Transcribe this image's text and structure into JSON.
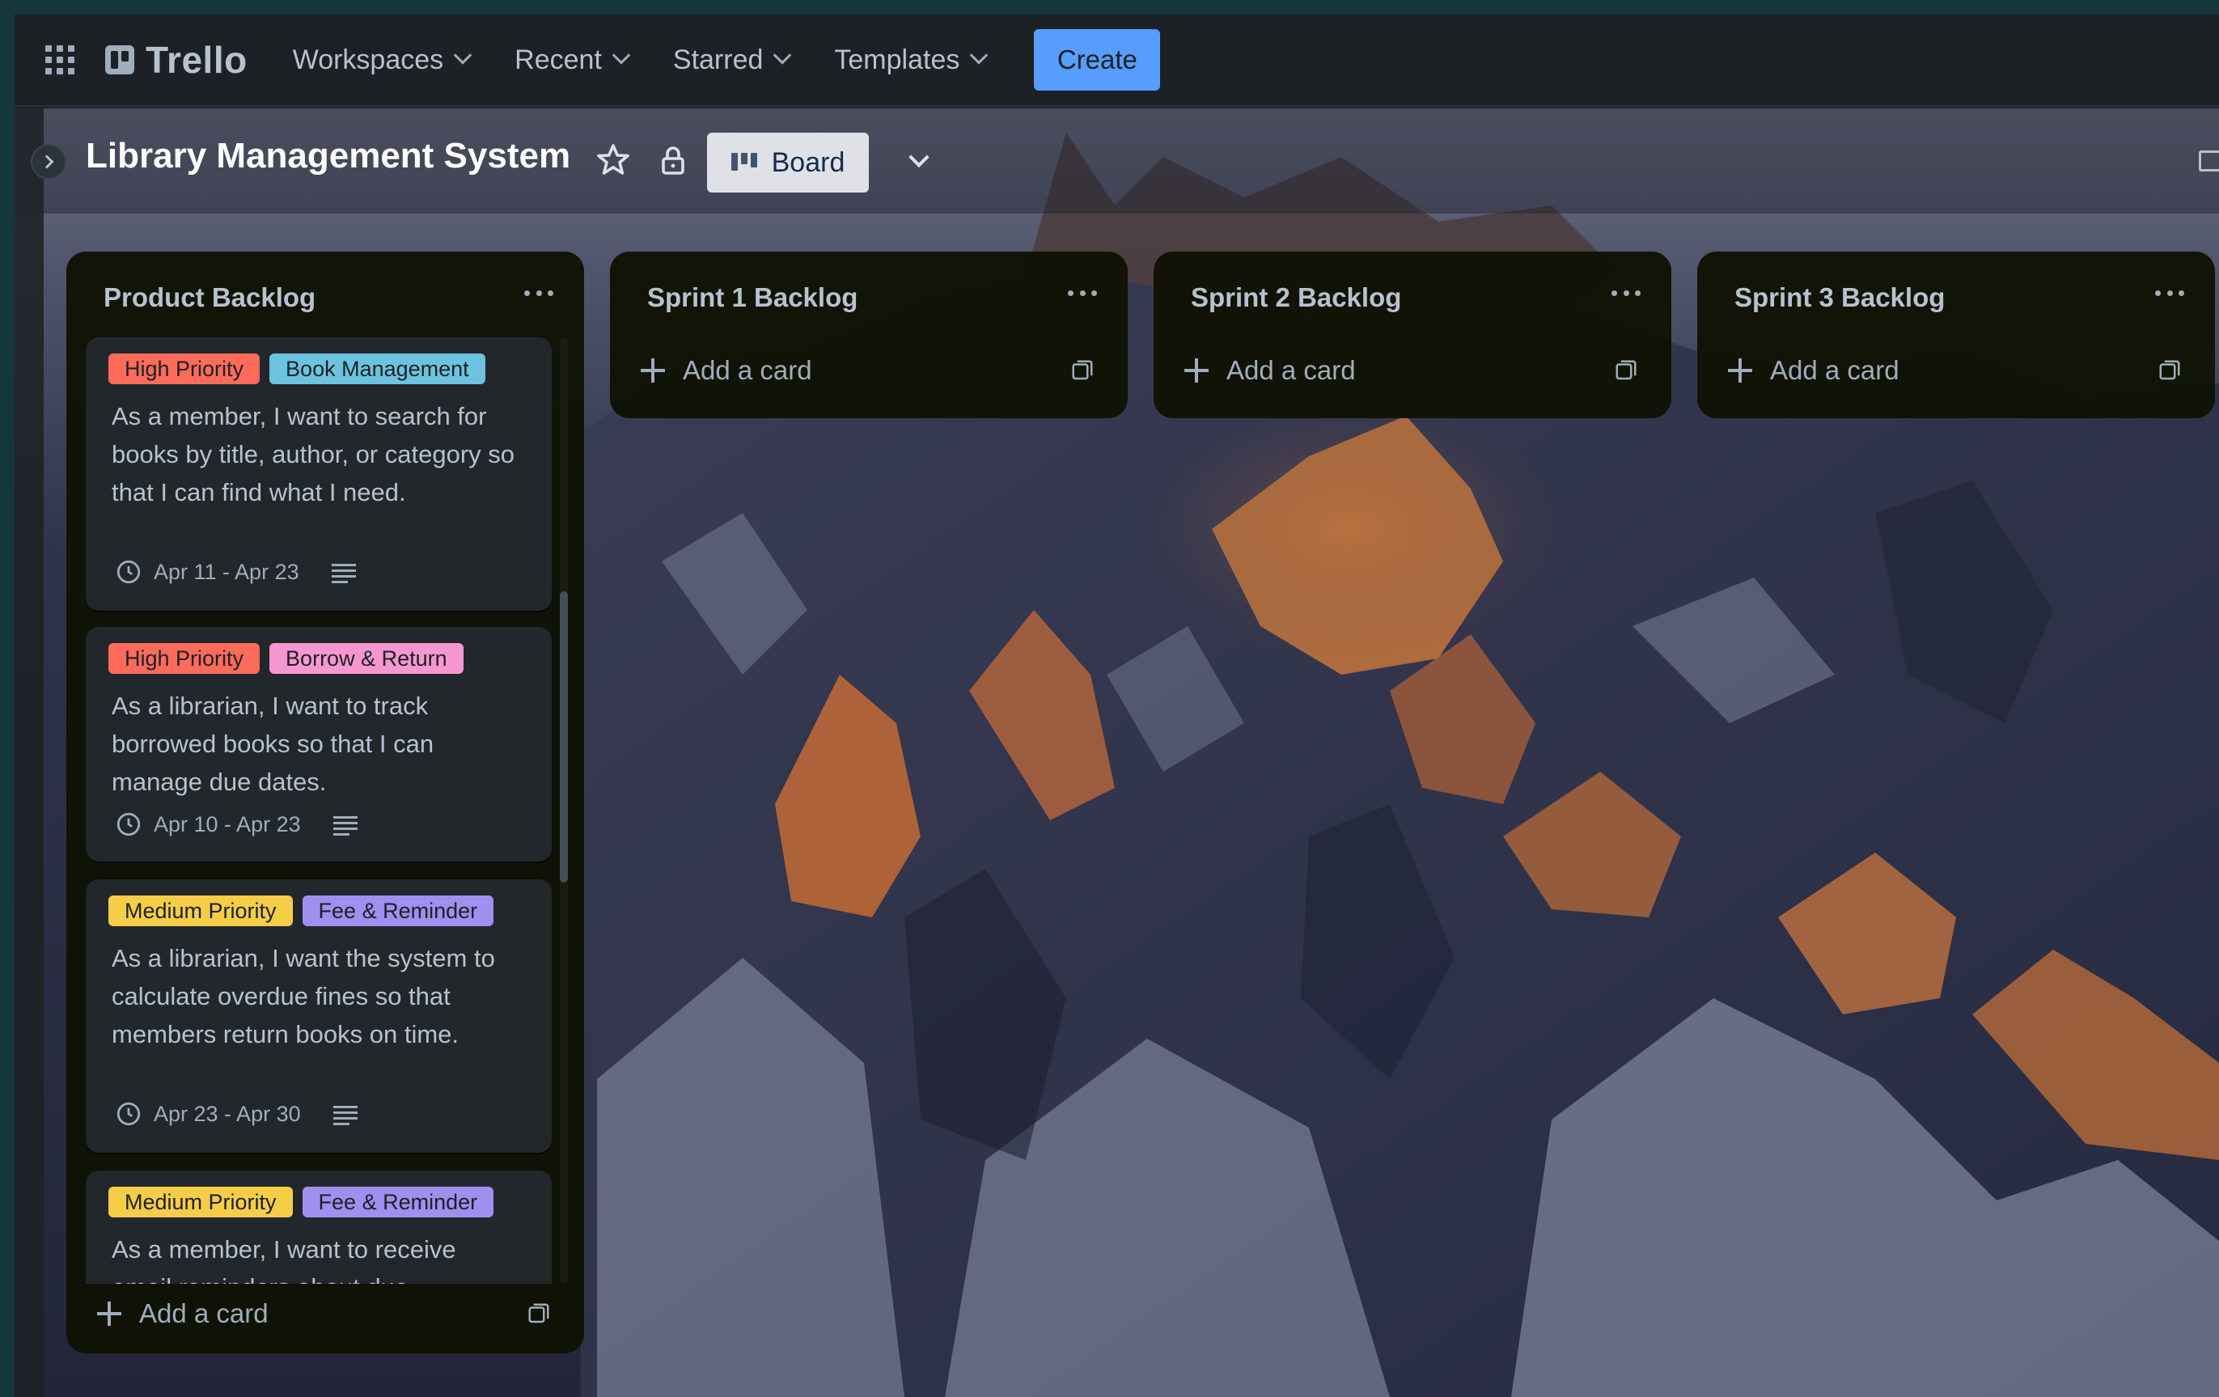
{
  "nav": {
    "logo_text": "Trello",
    "items": [
      {
        "label": "Workspaces"
      },
      {
        "label": "Recent"
      },
      {
        "label": "Starred"
      },
      {
        "label": "Templates"
      }
    ],
    "create_label": "Create"
  },
  "board": {
    "title": "Library Management System",
    "view_label": "Board"
  },
  "lists": [
    {
      "title": "Product Backlog",
      "add_card_label": "Add a card",
      "cards": [
        {
          "labels": [
            {
              "text": "High Priority",
              "bg": "#ff6b5b",
              "fg": "#1d2125"
            },
            {
              "text": "Book Management",
              "bg": "#6cc3e0",
              "fg": "#1d2125"
            }
          ],
          "text": "As a member, I want to search for books by title, author, or category so that I can find what I need.",
          "dates": "Apr 11 - Apr 23"
        },
        {
          "labels": [
            {
              "text": "High Priority",
              "bg": "#ff6b5b",
              "fg": "#1d2125"
            },
            {
              "text": "Borrow & Return",
              "bg": "#f797d2",
              "fg": "#1d2125"
            }
          ],
          "text": "As a librarian, I want to track borrowed books so that I can manage due dates.",
          "dates": "Apr 10 - Apr 23"
        },
        {
          "labels": [
            {
              "text": "Medium Priority",
              "bg": "#f5cd47",
              "fg": "#1d2125"
            },
            {
              "text": "Fee & Reminder",
              "bg": "#9f8fef",
              "fg": "#1d2125"
            }
          ],
          "text": "As a librarian, I want the system to calculate overdue fines so that members return books on time.",
          "dates": "Apr 23 - Apr 30"
        },
        {
          "labels": [
            {
              "text": "Medium Priority",
              "bg": "#f5cd47",
              "fg": "#1d2125"
            },
            {
              "text": "Fee & Reminder",
              "bg": "#9f8fef",
              "fg": "#1d2125"
            }
          ],
          "text": "As a member, I want to receive email reminders about due",
          "dates": ""
        }
      ]
    },
    {
      "title": "Sprint 1 Backlog",
      "add_card_label": "Add a card",
      "cards": []
    },
    {
      "title": "Sprint 2 Backlog",
      "add_card_label": "Add a card",
      "cards": []
    },
    {
      "title": "Sprint 3 Backlog",
      "add_card_label": "Add a card",
      "cards": []
    }
  ],
  "icons": {
    "apps": "apps-grid-icon",
    "star": "star-icon",
    "lock": "lock-icon",
    "board": "board-icon",
    "clock": "clock-icon",
    "description": "description-icon",
    "template": "card-template-icon"
  },
  "colors": {
    "nav_bg": "#1d2125",
    "create_button": "#579dff",
    "list_bg": "#101204",
    "card_bg": "#22272b"
  }
}
